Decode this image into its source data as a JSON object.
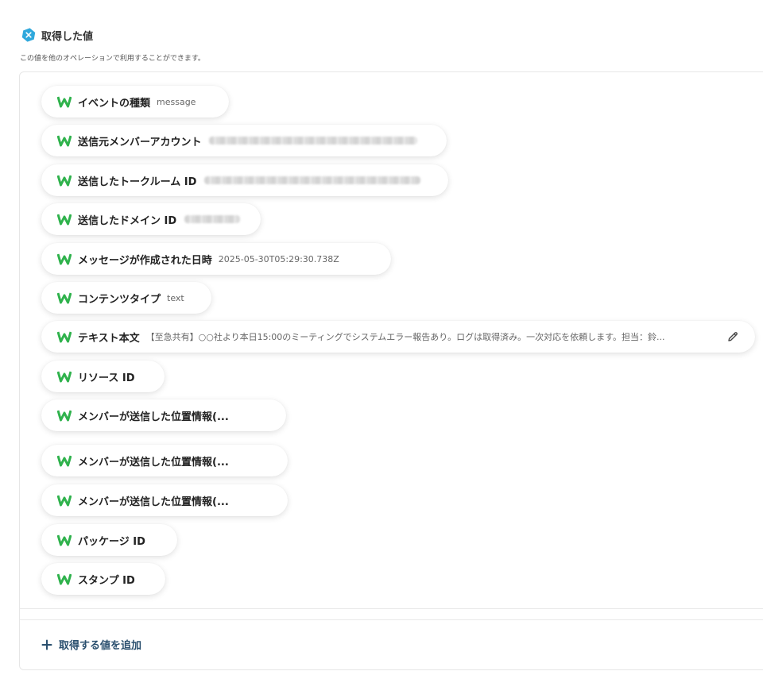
{
  "section": {
    "title": "取得した値",
    "description": "この値を他のオペレーションで利用することができます。",
    "icon": "close-hexagon-icon",
    "accent_color": "#2fa8dc"
  },
  "fields": [
    {
      "label": "イベントの種類",
      "value": "message"
    },
    {
      "label": "送信元メンバーアカウント",
      "value": "",
      "redacted": true
    },
    {
      "label": "送信したトークルーム ID",
      "value": "",
      "redacted": true
    },
    {
      "label": "送信したドメイン ID",
      "value": "",
      "redacted": true
    },
    {
      "label": "メッセージが作成された日時",
      "value": "2025-05-30T05:29:30.738Z"
    },
    {
      "label": "コンテンツタイプ",
      "value": "text"
    },
    {
      "label": "テキスト本文",
      "value": "【至急共有】○○社より本日15:00のミーティングでシステムエラー報告あり。ログは取得済み。一次対応を依頼します。担当：鈴..."
    },
    {
      "label": "リソース ID",
      "value": ""
    },
    {
      "label": "メンバーが送信した位置情報(...",
      "value": ""
    },
    {
      "label": "メンバーが送信した位置情報(...",
      "value": ""
    },
    {
      "label": "メンバーが送信した位置情報(...",
      "value": ""
    },
    {
      "label": "パッケージ ID",
      "value": ""
    },
    {
      "label": "スタンプ ID",
      "value": ""
    }
  ],
  "field_icon": "lineworks-logo-icon",
  "edit_icon": "pencil-icon",
  "add_button": {
    "label": "取得する値を追加",
    "icon": "plus-icon"
  },
  "colors": {
    "logo_green": "#2fb24c",
    "add_button": "#2a4f6e"
  }
}
